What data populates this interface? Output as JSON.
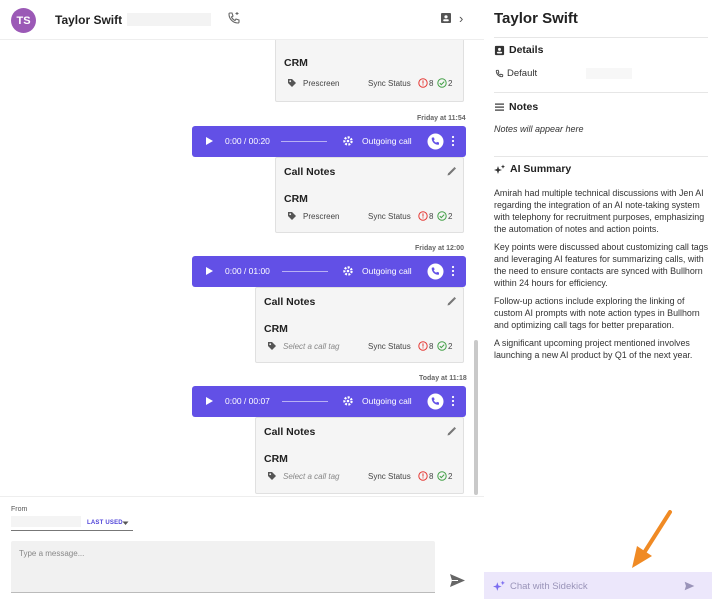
{
  "header": {
    "avatar_initials": "TS",
    "contact_name": "Taylor Swift"
  },
  "thread": {
    "cards": [
      {
        "crm": "CRM",
        "tag": "Prescreen",
        "sync_label": "Sync Status",
        "errors": "8",
        "synced": "2"
      },
      {
        "title": "Call Notes",
        "crm": "CRM",
        "tag": "Prescreen",
        "sync_label": "Sync Status",
        "errors": "8",
        "synced": "2"
      },
      {
        "title": "Call Notes",
        "crm": "CRM",
        "tag": "Select a call tag",
        "sync_label": "Sync Status",
        "errors": "8",
        "synced": "2"
      },
      {
        "title": "Call Notes",
        "crm": "CRM",
        "tag": "Select a call tag",
        "sync_label": "Sync Status",
        "errors": "8",
        "synced": "2"
      }
    ],
    "calls": [
      {
        "timestamp": "Friday at 11:54",
        "time": "0:00 / 00:20",
        "direction": "Outgoing call"
      },
      {
        "timestamp": "Friday at 12:00",
        "time": "0:00 / 01:00",
        "direction": "Outgoing call"
      },
      {
        "timestamp": "Today at 11:18",
        "time": "0:00 / 00:07",
        "direction": "Outgoing call"
      }
    ]
  },
  "composer": {
    "from_label": "From",
    "last_used": "LAST USED",
    "message_placeholder": "Type a message..."
  },
  "sidebar": {
    "title": "Taylor Swift",
    "details_heading": "Details",
    "phone_label": "Default",
    "notes_heading": "Notes",
    "notes_placeholder": "Notes will appear here",
    "summary_heading": "AI Summary",
    "summary_paragraphs": [
      "Amirah had multiple technical discussions with Jen AI regarding the integration of an AI note-taking system with telephony for recruitment purposes, emphasizing the automation of notes and action points.",
      "Key points were discussed about customizing call tags and leveraging AI features for summarizing calls, with the need to ensure contacts are synced with Bullhorn within 24 hours for efficiency.",
      "Follow-up actions include exploring the linking of custom AI prompts with note action types in Bullhorn and optimizing call tags for better preparation.",
      "A significant upcoming project mentioned involves launching a new AI product by Q1 of the next year."
    ],
    "chat_placeholder": "Chat with Sidekick"
  },
  "colors": {
    "accent": "#6250e6",
    "avatar": "#9b59b6",
    "error": "#e53935",
    "success": "#43a047",
    "annotation_arrow": "#f08a24"
  },
  "icons": [
    "phone-icon",
    "contact-card-icon",
    "chevron-right-icon",
    "tag-icon",
    "error-circle-icon",
    "check-circle-icon",
    "pencil-icon",
    "play-icon",
    "gear-icon",
    "phone-badge-icon",
    "more-vertical-icon",
    "send-icon",
    "sparkle-icon",
    "lines-icon",
    "caret-down-icon"
  ]
}
